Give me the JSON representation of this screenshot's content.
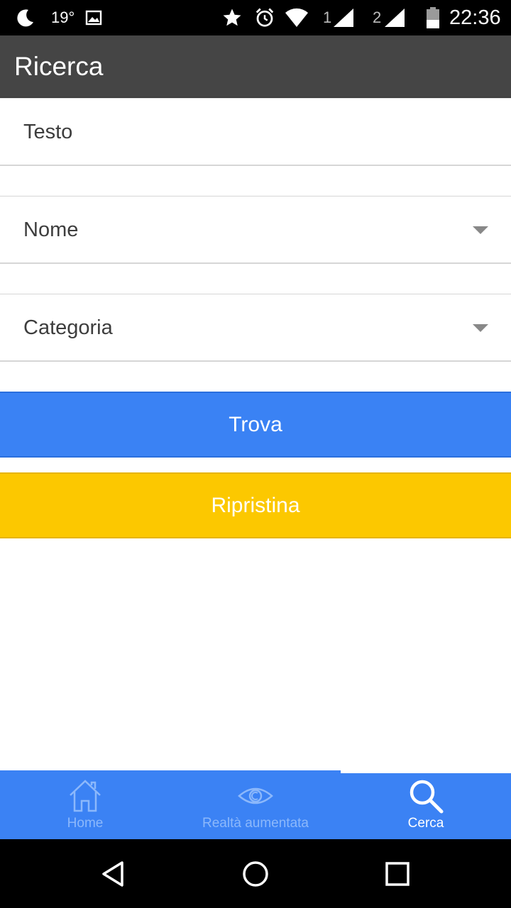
{
  "status_bar": {
    "temperature": "19°",
    "sim1": "1",
    "sim2": "2",
    "time": "22:36",
    "icons": [
      "moon-icon",
      "image-icon",
      "star-icon",
      "alarm-icon",
      "wifi-icon",
      "signal-icon",
      "battery-icon"
    ]
  },
  "app_bar": {
    "title": "Ricerca",
    "background": "#454545"
  },
  "form": {
    "text_field": {
      "label": "Testo"
    },
    "name_select": {
      "label": "Nome"
    },
    "category_select": {
      "label": "Categoria"
    }
  },
  "buttons": {
    "find": {
      "label": "Trova",
      "color": "#3a82f4"
    },
    "reset": {
      "label": "Ripristina",
      "color": "#fcc800"
    }
  },
  "tabs": [
    {
      "label": "Home",
      "icon": "home-icon",
      "active": false
    },
    {
      "label": "Realtà aumentata",
      "icon": "eye-icon",
      "active": false
    },
    {
      "label": "Cerca",
      "icon": "search-icon",
      "active": true
    }
  ],
  "tab_bar": {
    "color": "#3b82f4"
  },
  "nav_bar": {
    "icons": [
      "back-icon",
      "home-circle-icon",
      "recents-icon"
    ]
  }
}
